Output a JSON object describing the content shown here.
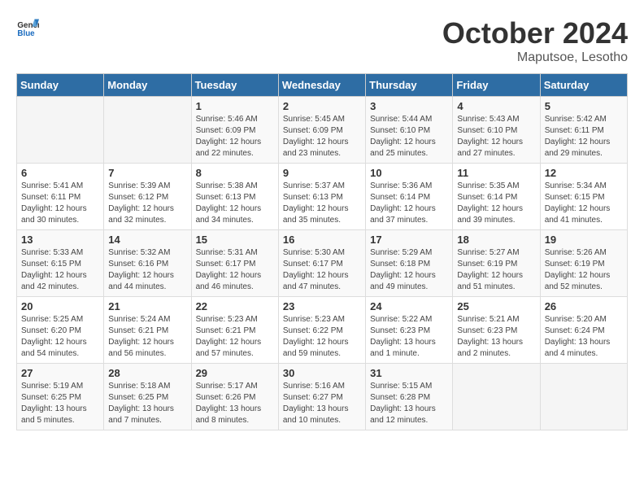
{
  "header": {
    "logo_general": "General",
    "logo_blue": "Blue",
    "month": "October 2024",
    "location": "Maputsoe, Lesotho"
  },
  "days_of_week": [
    "Sunday",
    "Monday",
    "Tuesday",
    "Wednesday",
    "Thursday",
    "Friday",
    "Saturday"
  ],
  "weeks": [
    [
      {
        "day": "",
        "content": ""
      },
      {
        "day": "",
        "content": ""
      },
      {
        "day": "1",
        "content": "Sunrise: 5:46 AM\nSunset: 6:09 PM\nDaylight: 12 hours and 22 minutes."
      },
      {
        "day": "2",
        "content": "Sunrise: 5:45 AM\nSunset: 6:09 PM\nDaylight: 12 hours and 23 minutes."
      },
      {
        "day": "3",
        "content": "Sunrise: 5:44 AM\nSunset: 6:10 PM\nDaylight: 12 hours and 25 minutes."
      },
      {
        "day": "4",
        "content": "Sunrise: 5:43 AM\nSunset: 6:10 PM\nDaylight: 12 hours and 27 minutes."
      },
      {
        "day": "5",
        "content": "Sunrise: 5:42 AM\nSunset: 6:11 PM\nDaylight: 12 hours and 29 minutes."
      }
    ],
    [
      {
        "day": "6",
        "content": "Sunrise: 5:41 AM\nSunset: 6:11 PM\nDaylight: 12 hours and 30 minutes."
      },
      {
        "day": "7",
        "content": "Sunrise: 5:39 AM\nSunset: 6:12 PM\nDaylight: 12 hours and 32 minutes."
      },
      {
        "day": "8",
        "content": "Sunrise: 5:38 AM\nSunset: 6:13 PM\nDaylight: 12 hours and 34 minutes."
      },
      {
        "day": "9",
        "content": "Sunrise: 5:37 AM\nSunset: 6:13 PM\nDaylight: 12 hours and 35 minutes."
      },
      {
        "day": "10",
        "content": "Sunrise: 5:36 AM\nSunset: 6:14 PM\nDaylight: 12 hours and 37 minutes."
      },
      {
        "day": "11",
        "content": "Sunrise: 5:35 AM\nSunset: 6:14 PM\nDaylight: 12 hours and 39 minutes."
      },
      {
        "day": "12",
        "content": "Sunrise: 5:34 AM\nSunset: 6:15 PM\nDaylight: 12 hours and 41 minutes."
      }
    ],
    [
      {
        "day": "13",
        "content": "Sunrise: 5:33 AM\nSunset: 6:15 PM\nDaylight: 12 hours and 42 minutes."
      },
      {
        "day": "14",
        "content": "Sunrise: 5:32 AM\nSunset: 6:16 PM\nDaylight: 12 hours and 44 minutes."
      },
      {
        "day": "15",
        "content": "Sunrise: 5:31 AM\nSunset: 6:17 PM\nDaylight: 12 hours and 46 minutes."
      },
      {
        "day": "16",
        "content": "Sunrise: 5:30 AM\nSunset: 6:17 PM\nDaylight: 12 hours and 47 minutes."
      },
      {
        "day": "17",
        "content": "Sunrise: 5:29 AM\nSunset: 6:18 PM\nDaylight: 12 hours and 49 minutes."
      },
      {
        "day": "18",
        "content": "Sunrise: 5:27 AM\nSunset: 6:19 PM\nDaylight: 12 hours and 51 minutes."
      },
      {
        "day": "19",
        "content": "Sunrise: 5:26 AM\nSunset: 6:19 PM\nDaylight: 12 hours and 52 minutes."
      }
    ],
    [
      {
        "day": "20",
        "content": "Sunrise: 5:25 AM\nSunset: 6:20 PM\nDaylight: 12 hours and 54 minutes."
      },
      {
        "day": "21",
        "content": "Sunrise: 5:24 AM\nSunset: 6:21 PM\nDaylight: 12 hours and 56 minutes."
      },
      {
        "day": "22",
        "content": "Sunrise: 5:23 AM\nSunset: 6:21 PM\nDaylight: 12 hours and 57 minutes."
      },
      {
        "day": "23",
        "content": "Sunrise: 5:23 AM\nSunset: 6:22 PM\nDaylight: 12 hours and 59 minutes."
      },
      {
        "day": "24",
        "content": "Sunrise: 5:22 AM\nSunset: 6:23 PM\nDaylight: 13 hours and 1 minute."
      },
      {
        "day": "25",
        "content": "Sunrise: 5:21 AM\nSunset: 6:23 PM\nDaylight: 13 hours and 2 minutes."
      },
      {
        "day": "26",
        "content": "Sunrise: 5:20 AM\nSunset: 6:24 PM\nDaylight: 13 hours and 4 minutes."
      }
    ],
    [
      {
        "day": "27",
        "content": "Sunrise: 5:19 AM\nSunset: 6:25 PM\nDaylight: 13 hours and 5 minutes."
      },
      {
        "day": "28",
        "content": "Sunrise: 5:18 AM\nSunset: 6:25 PM\nDaylight: 13 hours and 7 minutes."
      },
      {
        "day": "29",
        "content": "Sunrise: 5:17 AM\nSunset: 6:26 PM\nDaylight: 13 hours and 8 minutes."
      },
      {
        "day": "30",
        "content": "Sunrise: 5:16 AM\nSunset: 6:27 PM\nDaylight: 13 hours and 10 minutes."
      },
      {
        "day": "31",
        "content": "Sunrise: 5:15 AM\nSunset: 6:28 PM\nDaylight: 13 hours and 12 minutes."
      },
      {
        "day": "",
        "content": ""
      },
      {
        "day": "",
        "content": ""
      }
    ]
  ]
}
